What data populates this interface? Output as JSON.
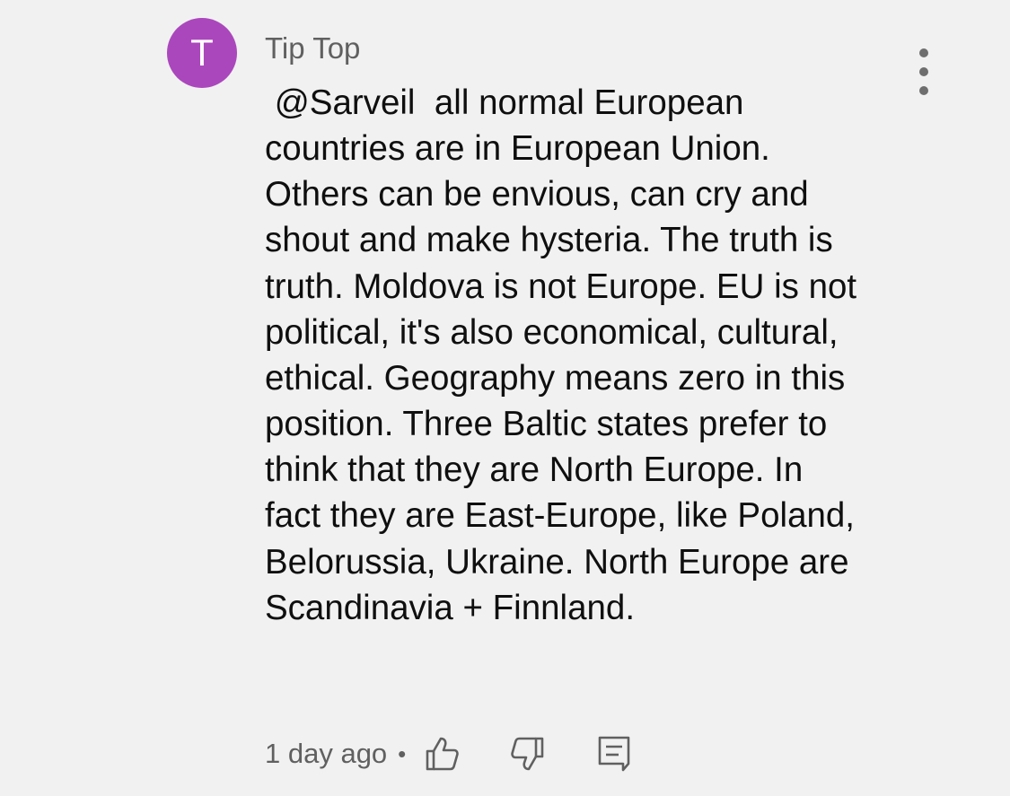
{
  "comment": {
    "avatar_letter": "T",
    "avatar_color": "#ab47bc",
    "author": "Tip Top",
    "text": " @Sarveil  all normal European countries are in European Union. Others can be envious, can cry and shout and make hysteria. The truth is truth. Moldova is not Europe. EU is not political, it's also economical, cultural, ethical. Geography means zero in this position. Three Baltic states prefer to think that they are North Europe. In fact they are East-Europe, like Poland, Belorussia, Ukraine. North Europe are Scandinavia + Finnland.",
    "timestamp": "1 day ago",
    "separator": "•",
    "icons": {
      "more": "more-vertical-icon",
      "like": "thumbs-up-icon",
      "dislike": "thumbs-down-icon",
      "reply": "reply-comment-icon"
    }
  }
}
